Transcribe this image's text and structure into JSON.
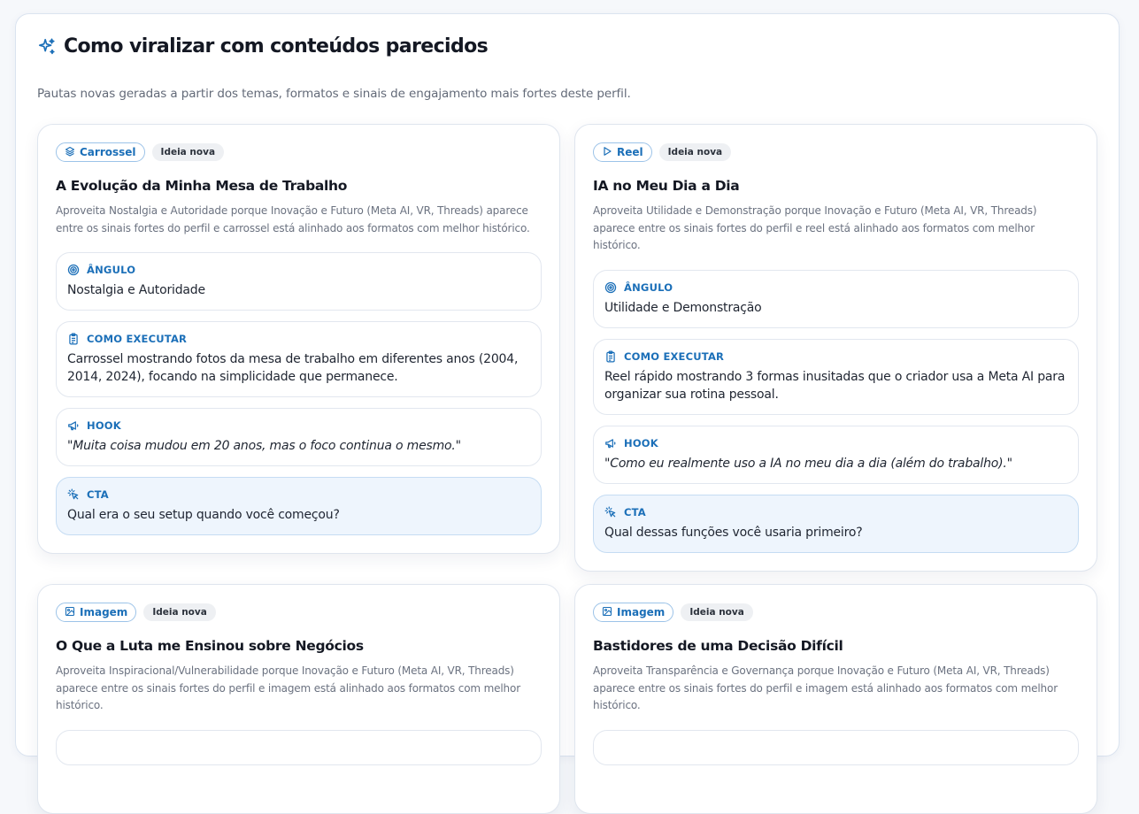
{
  "header": {
    "icon": "sparkles-icon",
    "title": "Como viralizar com conteúdos parecidos",
    "subtitle": "Pautas novas geradas a partir dos temas, formatos e sinais de engajamento mais fortes deste perfil."
  },
  "colors": {
    "accent": "#1b6fb8",
    "cta_background": "#eef5fd",
    "badge_background": "#eef0f3"
  },
  "labels": {
    "angle": "ÂNGULO",
    "execute": "COMO EXECUTAR",
    "hook": "HOOK",
    "cta": "CTA"
  },
  "ideas": [
    {
      "format": "Carrossel",
      "format_icon": "layers-icon",
      "badge": "Ideia nova",
      "title": "A Evolução da Minha Mesa de Trabalho",
      "description": "Aproveita Nostalgia e Autoridade porque Inovação e Futuro (Meta AI, VR, Threads) aparece entre os sinais fortes do perfil e carrossel está alinhado aos formatos com melhor histórico.",
      "angle": "Nostalgia e Autoridade",
      "execute": "Carrossel mostrando fotos da mesa de trabalho em diferentes anos (2004, 2014, 2024), focando na simplicidade que permanece.",
      "hook": "\"Muita coisa mudou em 20 anos, mas o foco continua o mesmo.\"",
      "cta": "Qual era o seu setup quando você começou?"
    },
    {
      "format": "Reel",
      "format_icon": "play-icon",
      "badge": "Ideia nova",
      "title": "IA no Meu Dia a Dia",
      "description": "Aproveita Utilidade e Demonstração porque Inovação e Futuro (Meta AI, VR, Threads) aparece entre os sinais fortes do perfil e reel está alinhado aos formatos com melhor histórico.",
      "angle": "Utilidade e Demonstração",
      "execute": "Reel rápido mostrando 3 formas inusitadas que o criador usa a Meta AI para organizar sua rotina pessoal.",
      "hook": "\"Como eu realmente uso a IA no meu dia a dia (além do trabalho).\"",
      "cta": "Qual dessas funções você usaria primeiro?"
    },
    {
      "format": "Imagem",
      "format_icon": "image-icon",
      "badge": "Ideia nova",
      "title": "O Que a Luta me Ensinou sobre Negócios",
      "description": "Aproveita Inspiracional/Vulnerabilidade porque Inovação e Futuro (Meta AI, VR, Threads) aparece entre os sinais fortes do perfil e imagem está alinhado aos formatos com melhor histórico."
    },
    {
      "format": "Imagem",
      "format_icon": "image-icon",
      "badge": "Ideia nova",
      "title": "Bastidores de uma Decisão Difícil",
      "description": "Aproveita Transparência e Governança porque Inovação e Futuro (Meta AI, VR, Threads) aparece entre os sinais fortes do perfil e imagem está alinhado aos formatos com melhor histórico."
    }
  ]
}
